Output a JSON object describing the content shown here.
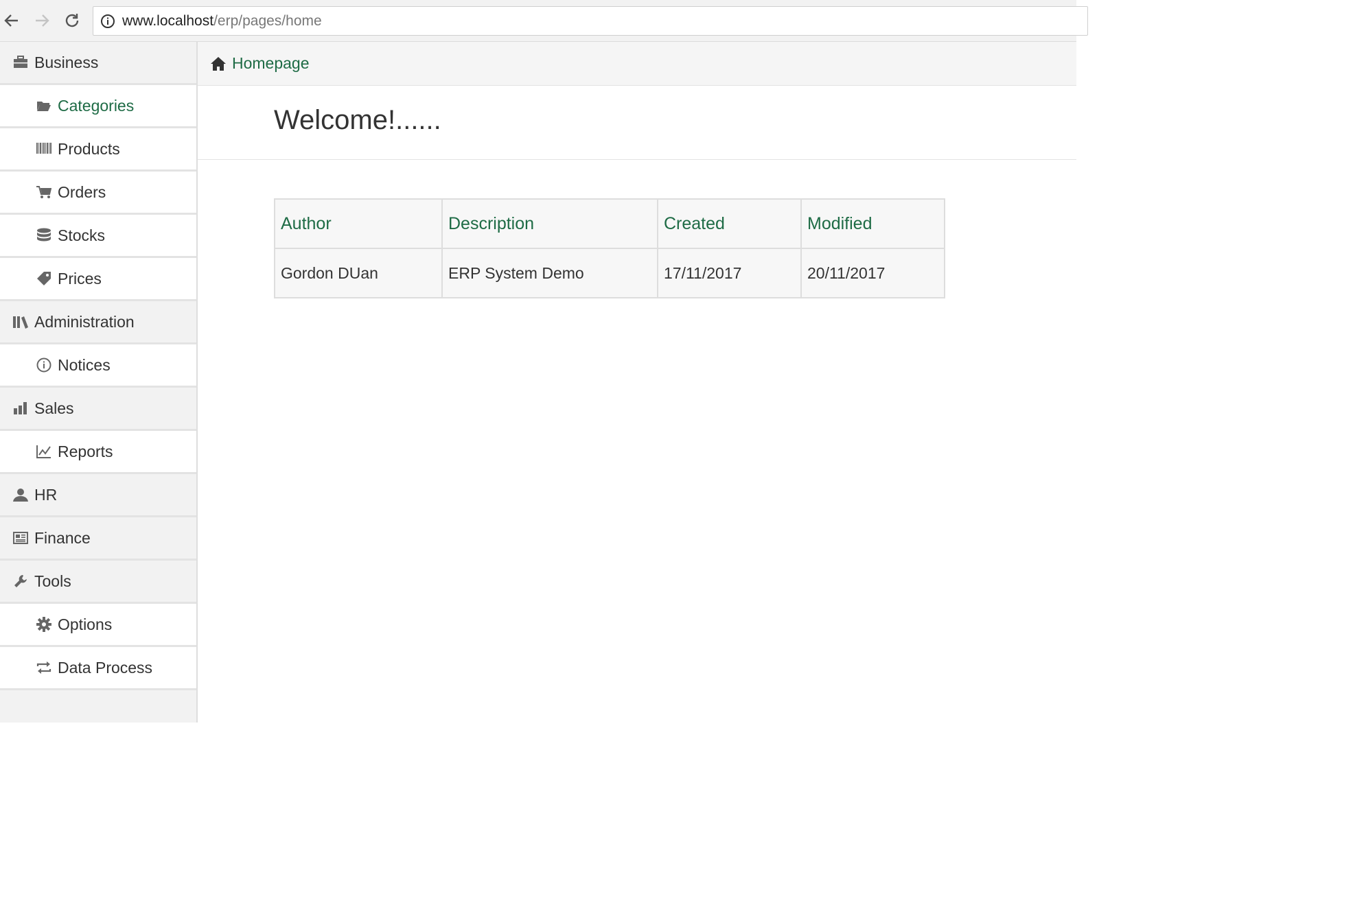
{
  "browser": {
    "url_host": "www.localhost",
    "url_path": "/erp/pages/home"
  },
  "sidebar": {
    "items": [
      {
        "label": "Business",
        "type": "group",
        "icon": "briefcase-icon"
      },
      {
        "label": "Categories",
        "type": "sub",
        "icon": "folder-open-icon",
        "active": true
      },
      {
        "label": "Products",
        "type": "sub",
        "icon": "barcode-icon"
      },
      {
        "label": "Orders",
        "type": "sub",
        "icon": "shopping-cart-icon"
      },
      {
        "label": "Stocks",
        "type": "sub",
        "icon": "database-icon"
      },
      {
        "label": "Prices",
        "type": "sub",
        "icon": "price-tag-icon"
      },
      {
        "label": "Administration",
        "type": "group",
        "icon": "library-icon"
      },
      {
        "label": "Notices",
        "type": "sub",
        "icon": "info-circle-icon"
      },
      {
        "label": "Sales",
        "type": "group",
        "icon": "bar-chart-icon"
      },
      {
        "label": "Reports",
        "type": "sub",
        "icon": "line-chart-icon"
      },
      {
        "label": "HR",
        "type": "group",
        "icon": "user-icon"
      },
      {
        "label": "Finance",
        "type": "group",
        "icon": "newspaper-icon"
      },
      {
        "label": "Tools",
        "type": "group",
        "icon": "wrench-icon"
      },
      {
        "label": "Options",
        "type": "sub",
        "icon": "cog-icon"
      },
      {
        "label": "Data Process",
        "type": "sub",
        "icon": "exchange-icon"
      }
    ]
  },
  "breadcrumb": {
    "label": "Homepage"
  },
  "main": {
    "title": "Welcome!......",
    "table": {
      "headers": [
        "Author",
        "Description",
        "Created",
        "Modified"
      ],
      "rows": [
        [
          "Gordon DUan",
          "ERP System Demo",
          "17/11/2017",
          "20/11/2017"
        ]
      ]
    }
  },
  "colors": {
    "accent": "#1e6b45",
    "sidebar_bg": "#f2f2f2",
    "text": "#333333"
  }
}
